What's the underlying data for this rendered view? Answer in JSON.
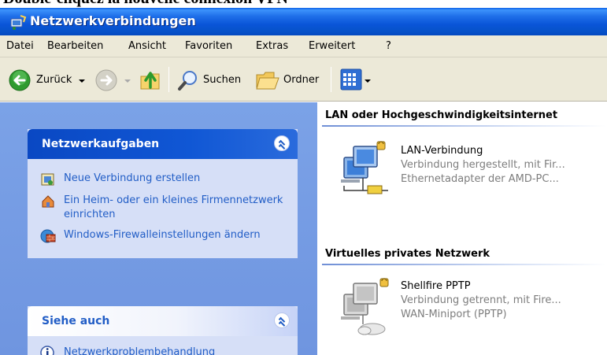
{
  "caption": "Double-cliquez la nouvelle connexion VPN",
  "window": {
    "title": "Netzwerkverbindungen"
  },
  "menu": [
    "Datei",
    "Bearbeiten",
    "Ansicht",
    "Favoriten",
    "Extras",
    "Erweitert",
    "?"
  ],
  "toolbar": {
    "back_label": "Zurück",
    "search_label": "Suchen",
    "folders_label": "Ordner"
  },
  "tasks_panel": {
    "title": "Netzwerkaufgaben",
    "items": [
      {
        "label": "Neue Verbindung erstellen",
        "icon": "new-connection-icon"
      },
      {
        "label": "Ein Heim- oder ein kleines Firmennetzwerk einrichten",
        "icon": "home-network-icon"
      },
      {
        "label": "Windows-Firewalleinstellungen ändern",
        "icon": "firewall-icon"
      }
    ]
  },
  "see_also_panel": {
    "title": "Siehe auch",
    "items": [
      {
        "label": "Netzwerkproblembehandlung",
        "icon": "info-icon"
      }
    ]
  },
  "groups": [
    {
      "header": "LAN oder Hochgeschwindigkeitsinternet",
      "connections": [
        {
          "name": "LAN-Verbindung",
          "status": "Verbindung hergestellt, mit Fir...",
          "device": "Ethernetadapter der AMD-PC..."
        }
      ]
    },
    {
      "header": "Virtuelles privates Netzwerk",
      "connections": [
        {
          "name": "Shellfire PPTP",
          "status": "Verbindung getrennt, mit Fire...",
          "device": "WAN-Miniport (PPTP)"
        }
      ]
    }
  ]
}
